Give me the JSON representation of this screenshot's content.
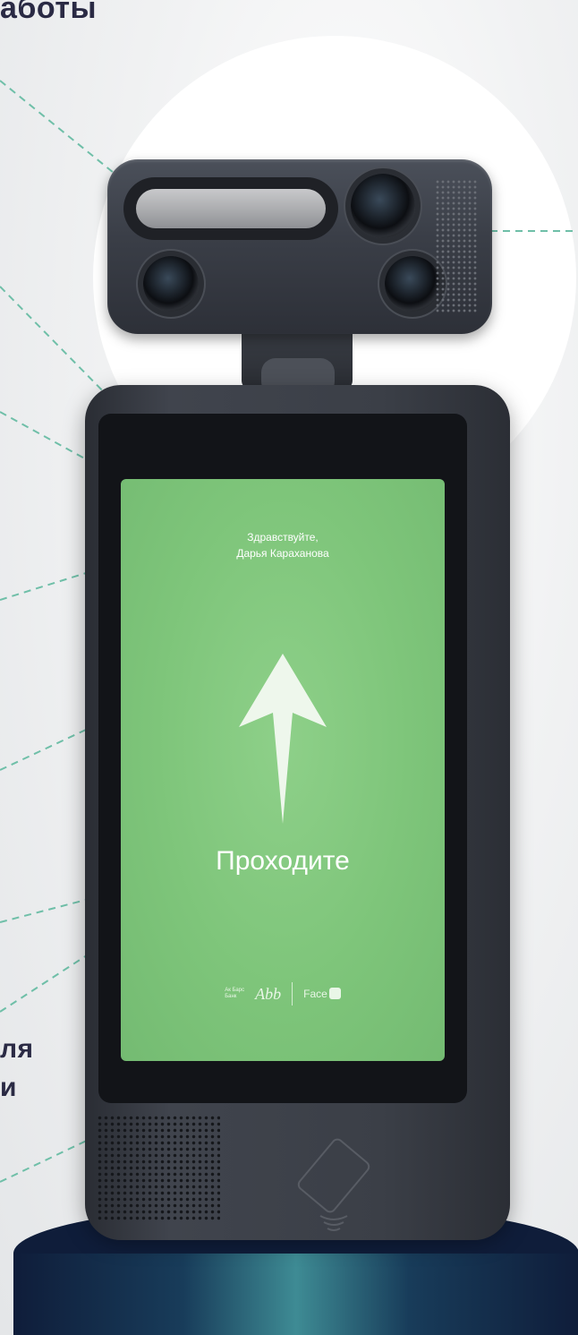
{
  "annotations": {
    "heading_fragment": "аботы",
    "label_fragment_1": "ля",
    "label_fragment_2": "и"
  },
  "device": {
    "screen": {
      "greeting_line_1": "Здравствуйте,",
      "greeting_line_2": "Дарья Караханова",
      "status_text": "Проходите",
      "logo_small_text": [
        "Ак Барс",
        "Банк"
      ],
      "logo_mark": "Abb",
      "logo_face": "Face",
      "screen_color": "#7ec57a"
    },
    "body_color": "#3b3f47",
    "pedestal_color": "#0f1d3a",
    "leader_line_color": "#6fbfa8"
  }
}
